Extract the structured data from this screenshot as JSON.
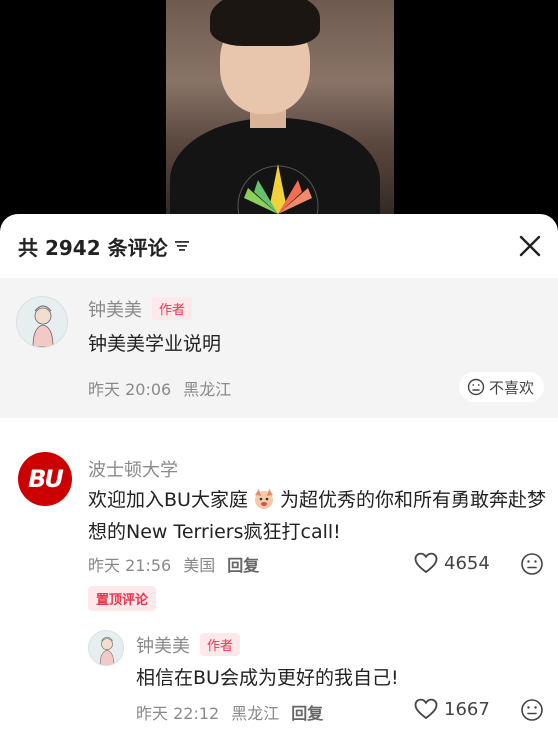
{
  "sheet": {
    "comment_count_label": "共 2942 条评论",
    "close_icon": "close-icon",
    "sort_icon": "sort-icon"
  },
  "pinned_note": {
    "author": "钟美美",
    "author_tag": "作者",
    "text": "钟美美学业说明",
    "time": "昨天 20:06",
    "location": "黑龙江",
    "dislike_label": "不喜欢"
  },
  "bu_comment": {
    "avatar_text": "BU",
    "author": "波士顿大学",
    "text_part1": "欢迎加入BU大家庭",
    "text_part2": "为超优秀的你和所有勇敢奔赴梦想的New Terriers疯狂打call!",
    "time": "昨天 21:56",
    "location": "美国",
    "reply_label": "回复",
    "like_count": "4654",
    "pinned_tag": "置顶评论"
  },
  "reply": {
    "author": "钟美美",
    "author_tag": "作者",
    "text": "相信在BU会成为更好的我自己!",
    "time": "昨天 22:12",
    "location": "黑龙江",
    "reply_label": "回复",
    "like_count": "1667"
  },
  "colors": {
    "accent_red": "#e8364d",
    "bu_red": "#cc0000",
    "note_bg": "#f4f4f4"
  }
}
